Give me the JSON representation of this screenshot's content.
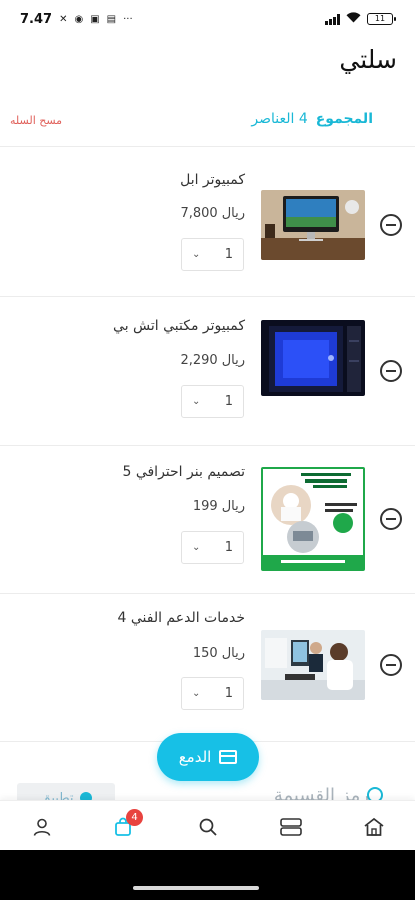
{
  "status_bar": {
    "time": "7.47",
    "battery": "11"
  },
  "header": {
    "title": "سلتي"
  },
  "summary": {
    "label": "المجموع",
    "count": "4 العناصر",
    "clear_label": "مسح السله"
  },
  "items": [
    {
      "name": "كمبيوتر ابل",
      "currency": "ريال",
      "price": "7,800",
      "qty": "1",
      "image_icon": "apple-computer-thumbnail"
    },
    {
      "name": "كمبيوتر مكتبي اتش بي",
      "currency": "ريال",
      "price": "2,290",
      "qty": "1",
      "image_icon": "hp-desktop-thumbnail"
    },
    {
      "name": "تصميم بنر احترافي 5",
      "currency": "ريال",
      "price": "199",
      "qty": "1",
      "image_icon": "banner-design-thumbnail"
    },
    {
      "name": "خدمات الدعم الفني 4",
      "currency": "ريال",
      "price": "150",
      "qty": "1",
      "image_icon": "tech-support-thumbnail"
    }
  ],
  "checkout": {
    "label": "الدمع",
    "icon": "credit-card-icon"
  },
  "coupon": {
    "label": "رمز القسيمة",
    "apply_label": "تطبيق"
  },
  "bottom_nav": {
    "cart_badge": "4",
    "items": [
      "profile-icon",
      "cart-icon",
      "search-icon",
      "categories-icon",
      "home-icon"
    ]
  },
  "colors": {
    "accent": "#17c0e6",
    "danger": "#e0605a",
    "badge": "#e8433f"
  }
}
